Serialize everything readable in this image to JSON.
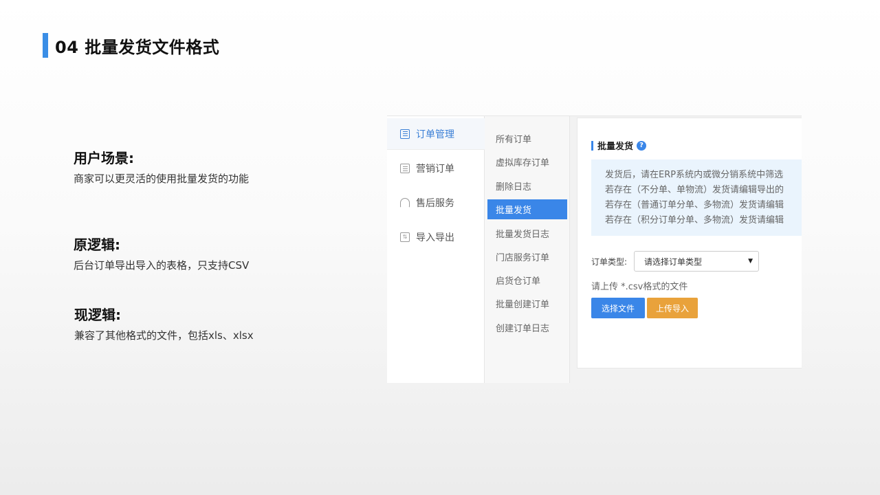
{
  "slide": {
    "title": "04 批量发货文件格式",
    "accent": "#3a8ee6"
  },
  "sections": [
    {
      "heading": "用户场景:",
      "text": "商家可以更灵活的使用批量发货的功能"
    },
    {
      "heading": "原逻辑:",
      "text": "后台订单导出导入的表格，只支持CSV"
    },
    {
      "heading": "现逻辑:",
      "text": "兼容了其他格式的文件，包括xls、xlsx"
    }
  ],
  "screenshot": {
    "primary_nav": [
      {
        "label": "订单管理",
        "icon": "order-doc-icon",
        "active": true
      },
      {
        "label": "营销订单",
        "icon": "marketing-doc-icon",
        "active": false
      },
      {
        "label": "售后服务",
        "icon": "headset-icon",
        "active": false
      },
      {
        "label": "导入导出",
        "icon": "import-export-icon",
        "active": false
      }
    ],
    "secondary_nav": [
      {
        "label": "所有订单",
        "active": false
      },
      {
        "label": "虚拟库存订单",
        "active": false
      },
      {
        "label": "删除日志",
        "active": false
      },
      {
        "label": "批量发货",
        "active": true
      },
      {
        "label": "批量发货日志",
        "active": false
      },
      {
        "label": "门店服务订单",
        "active": false
      },
      {
        "label": "启货仓订单",
        "active": false
      },
      {
        "label": "批量创建订单",
        "active": false
      },
      {
        "label": "创建订单日志",
        "active": false
      }
    ],
    "panel": {
      "title": "批量发货",
      "help_icon": "?",
      "notice": [
        "发货后，请在ERP系统内或微分销系统中筛选",
        "若存在（不分单、单物流）发货请编辑导出的",
        "若存在（普通订单分单、多物流）发货请编辑",
        "若存在（积分订单分单、多物流）发货请编辑"
      ],
      "order_type_label": "订单类型:",
      "order_type_value": "请选择订单类型",
      "upload_tip": "请上传 *.csv格式的文件",
      "choose_button": "选择文件",
      "upload_button": "上传导入",
      "colors": {
        "primary": "#3a86e8",
        "warning": "#e9a23b",
        "notice_bg": "#eaf4fd"
      }
    }
  }
}
